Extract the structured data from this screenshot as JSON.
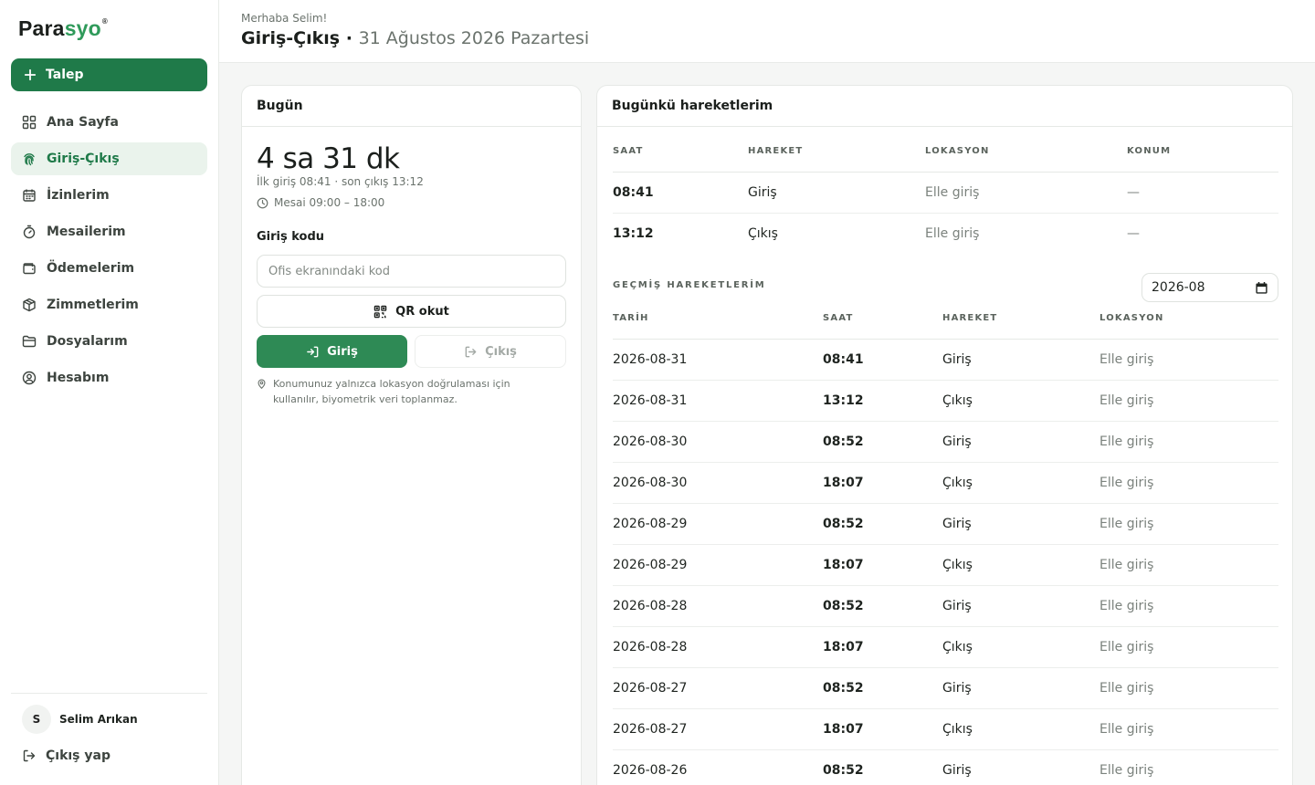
{
  "brand": {
    "name_a": "Para",
    "name_b": "syo",
    "mark": "®"
  },
  "sidebar": {
    "primary_button": "Talep",
    "items": [
      {
        "label": "Ana Sayfa",
        "icon": "grid-icon"
      },
      {
        "label": "Giriş-Çıkış",
        "icon": "fingerprint-icon",
        "active": true
      },
      {
        "label": "İzinlerim",
        "icon": "calendar-icon"
      },
      {
        "label": "Mesailerim",
        "icon": "stopwatch-icon"
      },
      {
        "label": "Ödemelerim",
        "icon": "wallet-icon"
      },
      {
        "label": "Zimmetlerim",
        "icon": "box-icon"
      },
      {
        "label": "Dosyalarım",
        "icon": "folder-icon"
      },
      {
        "label": "Hesabım",
        "icon": "user-circle-icon"
      }
    ],
    "user": {
      "initial": "S",
      "name": "Selim Arıkan"
    },
    "logout": "Çıkış yap"
  },
  "header": {
    "greeting": "Merhaba Selim!",
    "title": "Giriş-Çıkış",
    "separator": " · ",
    "date": "31 Ağustos 2026 Pazartesi"
  },
  "today": {
    "title": "Bugün",
    "duration": "4 sa 31 dk",
    "first_last": "İlk giriş 08:41 · son çıkış 13:12",
    "shift": "Mesai 09:00 – 18:00",
    "code_label": "Giriş kodu",
    "code_placeholder": "Ofis ekranındaki kod",
    "qr_label": "QR okut",
    "in_label": "Giriş",
    "out_label": "Çıkış",
    "privacy": "Konumunuz yalnızca lokasyon doğrulaması için kullanılır, biyometrik veri toplanmaz."
  },
  "moves": {
    "title": "Bugünkü hareketlerim",
    "columns": [
      "SAAT",
      "HAREKET",
      "LOKASYON",
      "KONUM"
    ],
    "rows": [
      {
        "time": "08:41",
        "type": "Giriş",
        "location": "Elle giriş",
        "position": "—"
      },
      {
        "time": "13:12",
        "type": "Çıkış",
        "location": "Elle giriş",
        "position": "—"
      }
    ]
  },
  "past": {
    "title": "GEÇMİŞ HAREKETLERİM",
    "month": "2026-08",
    "columns": [
      "TARİH",
      "SAAT",
      "HAREKET",
      "LOKASYON"
    ],
    "rows": [
      {
        "date": "2026-08-31",
        "time": "08:41",
        "type": "Giriş",
        "location": "Elle giriş"
      },
      {
        "date": "2026-08-31",
        "time": "13:12",
        "type": "Çıkış",
        "location": "Elle giriş"
      },
      {
        "date": "2026-08-30",
        "time": "08:52",
        "type": "Giriş",
        "location": "Elle giriş"
      },
      {
        "date": "2026-08-30",
        "time": "18:07",
        "type": "Çıkış",
        "location": "Elle giriş"
      },
      {
        "date": "2026-08-29",
        "time": "08:52",
        "type": "Giriş",
        "location": "Elle giriş"
      },
      {
        "date": "2026-08-29",
        "time": "18:07",
        "type": "Çıkış",
        "location": "Elle giriş"
      },
      {
        "date": "2026-08-28",
        "time": "08:52",
        "type": "Giriş",
        "location": "Elle giriş"
      },
      {
        "date": "2026-08-28",
        "time": "18:07",
        "type": "Çıkış",
        "location": "Elle giriş"
      },
      {
        "date": "2026-08-27",
        "time": "08:52",
        "type": "Giriş",
        "location": "Elle giriş"
      },
      {
        "date": "2026-08-27",
        "time": "18:07",
        "type": "Çıkış",
        "location": "Elle giriş"
      },
      {
        "date": "2026-08-26",
        "time": "08:52",
        "type": "Giriş",
        "location": "Elle giriş"
      }
    ]
  }
}
